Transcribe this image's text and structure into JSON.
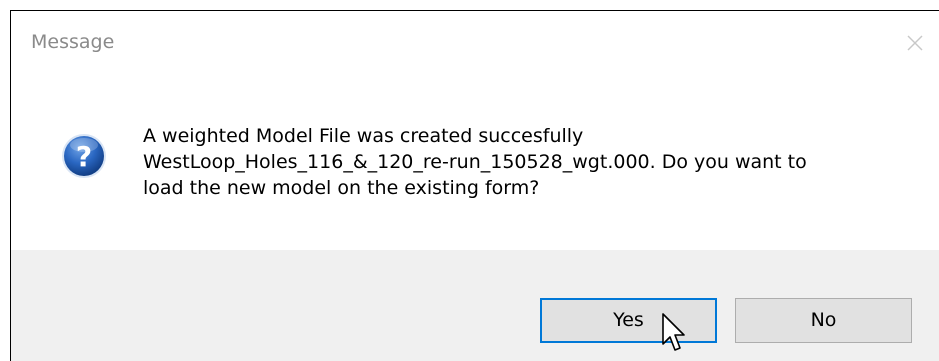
{
  "dialog": {
    "title": "Message",
    "message_line1": "A weighted Model File was created succesfully",
    "message_line2": "WestLoop_Holes_116_&_120_re-run_150528_wgt.000. Do you want to",
    "message_line3": "load the new model on the existing form?",
    "icon": "question-icon",
    "close_icon": "close-icon"
  },
  "buttons": {
    "yes_label": "Yes",
    "no_label": "No"
  },
  "colors": {
    "title": "#8a8a8a",
    "footer_bg": "#f0f0f0",
    "button_bg": "#e1e1e1",
    "default_button_border": "#0078d7",
    "icon_blue": "#1f5fb3"
  }
}
